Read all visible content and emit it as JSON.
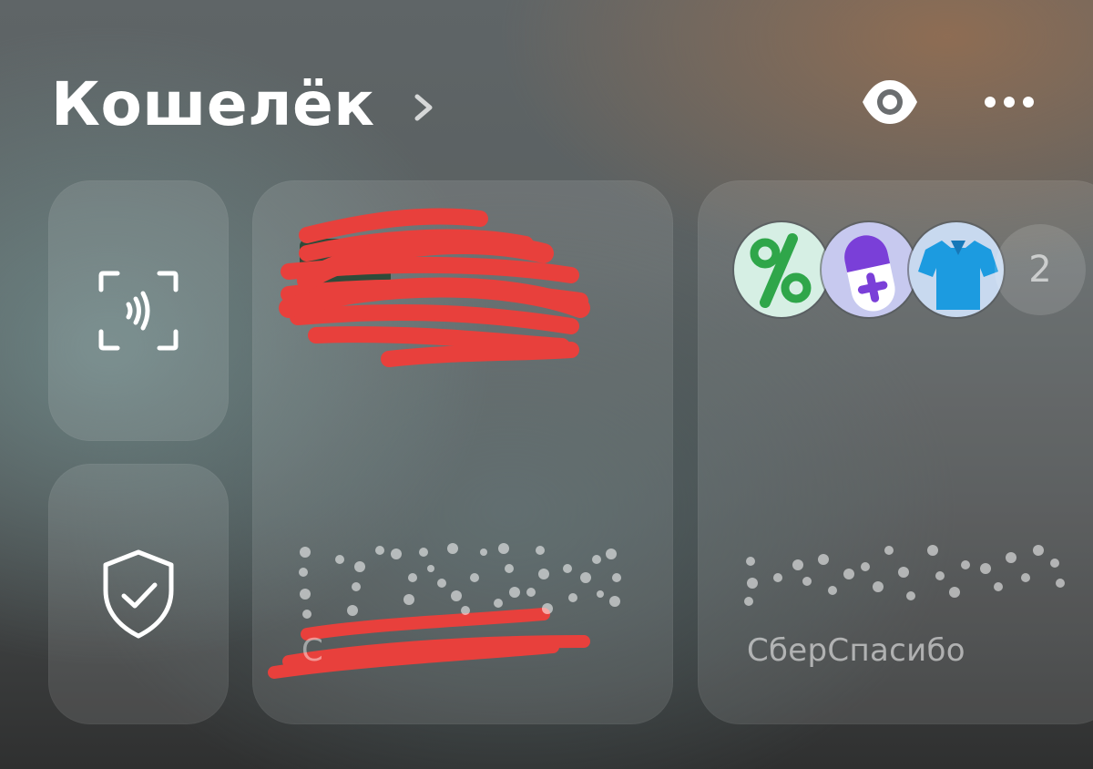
{
  "header": {
    "title": "Кошелёк",
    "icons": [
      "chevron-right-icon",
      "eye-icon",
      "more-icon"
    ]
  },
  "tiles": {
    "nfc": {
      "icon": "nfc-scan-icon"
    },
    "security": {
      "icon": "shield-check-icon"
    },
    "card": {
      "caption": "С"
    },
    "bonus": {
      "caption": "СберСпасибо",
      "badge_count": "2",
      "avatars": [
        "percent-icon",
        "pill-icon",
        "polo-shirt-icon"
      ]
    }
  },
  "colors": {
    "text": "#ffffff",
    "redaction": "#e8403c",
    "tile_bg": "rgba(255,255,255,0.11)"
  }
}
